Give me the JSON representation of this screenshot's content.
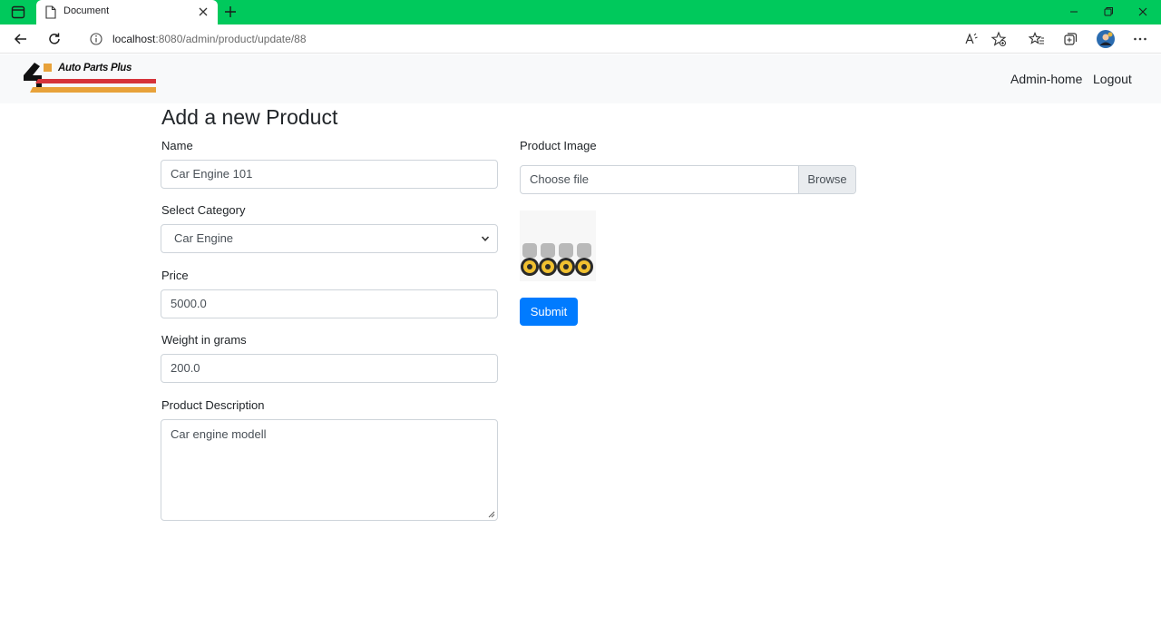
{
  "browser": {
    "tab_title": "Document",
    "url_host": "localhost",
    "url_path": ":8080/admin/product/update/88",
    "theme_color": "#00c95c"
  },
  "navbar": {
    "brand": "Auto Parts Plus",
    "links": [
      "Admin-home",
      "Logout"
    ]
  },
  "page": {
    "title": "Add a new Product"
  },
  "form": {
    "name_label": "Name",
    "name_value": "Car Engine 101",
    "category_label": "Select Category",
    "category_value": "Car Engine",
    "price_label": "Price",
    "price_value": "5000.0",
    "weight_label": "Weight in grams",
    "weight_value": "200.0",
    "description_label": "Product Description",
    "description_value": "Car engine modell",
    "image_label": "Product Image",
    "file_placeholder": "Choose file",
    "browse_label": "Browse",
    "submit_label": "Submit",
    "accent_color": "#007bff"
  }
}
